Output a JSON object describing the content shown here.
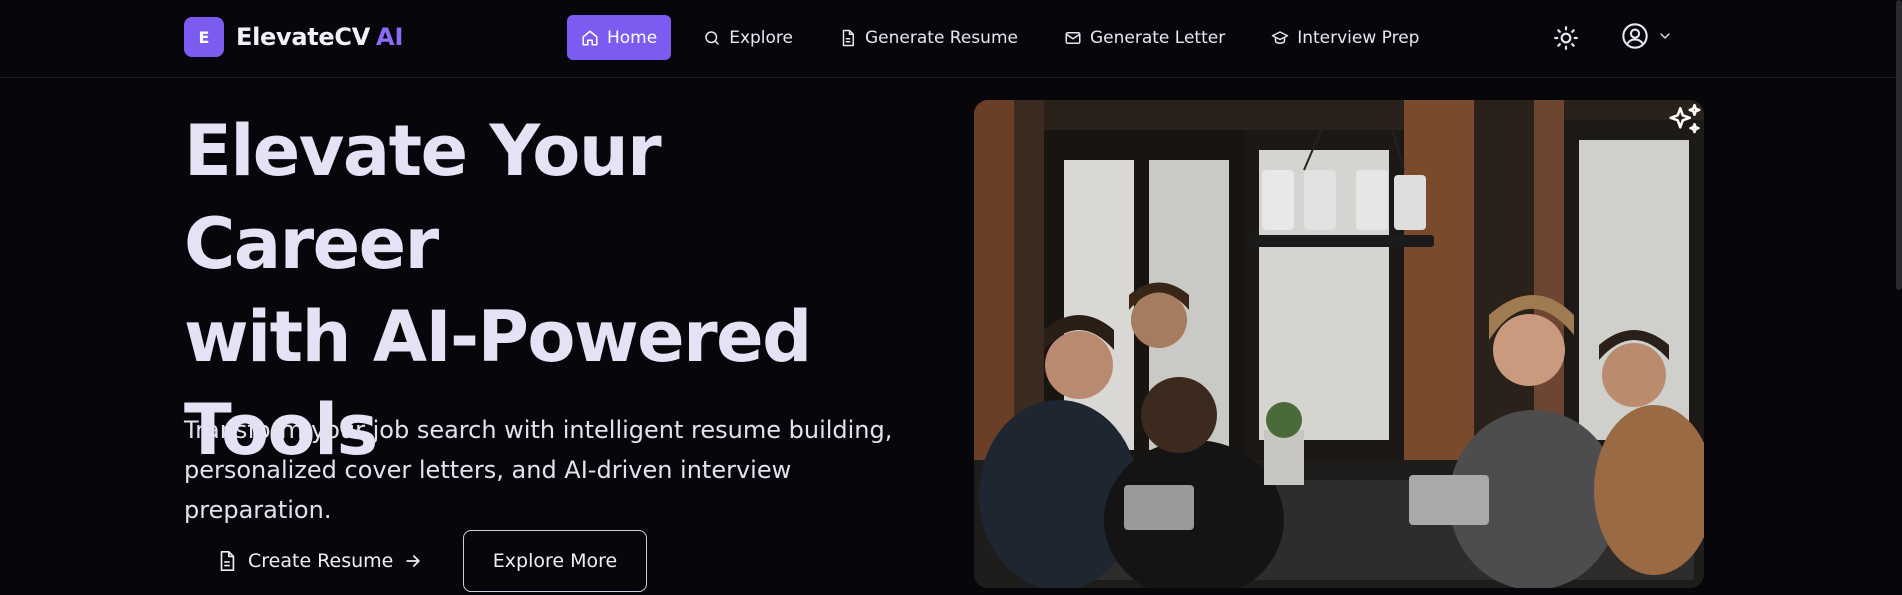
{
  "brand": {
    "logo_letter": "E",
    "name": "ElevateCV",
    "suffix": "AI"
  },
  "nav": {
    "home": "Home",
    "explore": "Explore",
    "generate_resume": "Generate Resume",
    "generate_letter": "Generate Letter",
    "interview_prep": "Interview Prep"
  },
  "hero": {
    "title_line1": "Elevate Your Career",
    "title_line2": "with AI-Powered",
    "title_line3": "Tools",
    "description_line1": "Transform your job search with intelligent resume building,",
    "description_line2": "personalized cover letters, and AI-driven interview preparation.",
    "cta_primary": "Create Resume",
    "cta_secondary": "Explore More"
  },
  "colors": {
    "accent": "#7c5cf0",
    "background": "#07070b",
    "text": "#e4e2f4"
  },
  "icons": [
    "home-icon",
    "search-icon",
    "document-icon",
    "mail-icon",
    "graduation-cap-icon",
    "sun-icon",
    "user-circle-icon",
    "chevron-down-icon",
    "arrow-right-icon",
    "sparkles-icon"
  ]
}
